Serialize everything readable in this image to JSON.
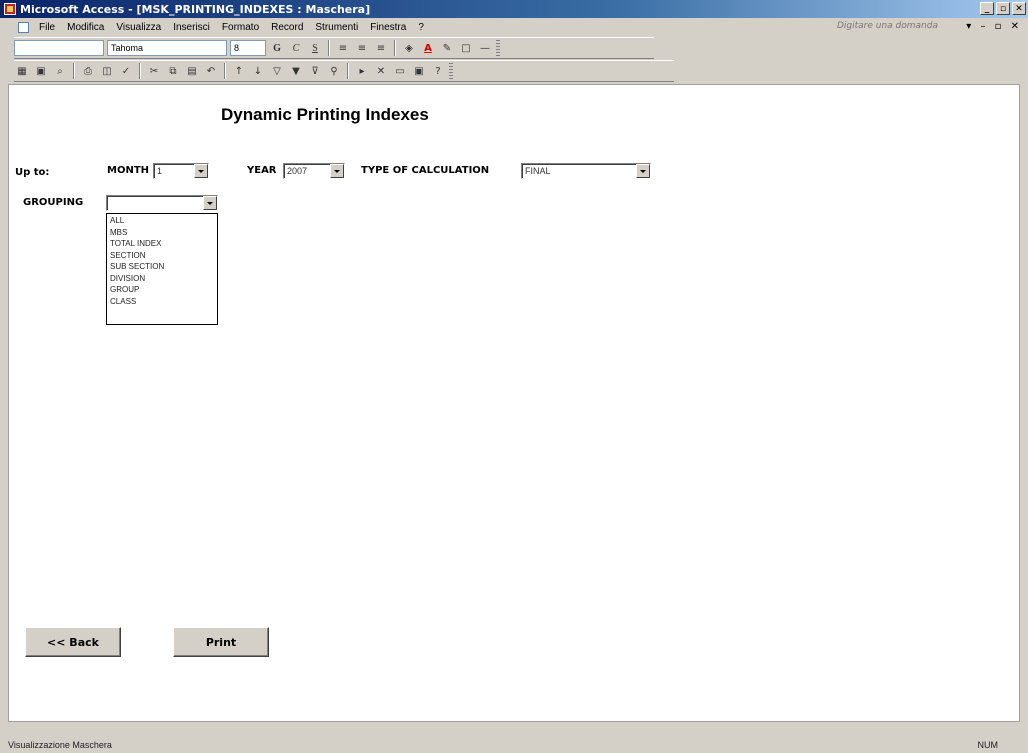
{
  "window": {
    "title": "Microsoft Access - [MSK_PRINTING_INDEXES : Maschera]"
  },
  "menubar": {
    "items": [
      "File",
      "Modifica",
      "Visualizza",
      "Inserisci",
      "Formato",
      "Record",
      "Strumenti",
      "Finestra",
      "?"
    ],
    "question_box": "Digitare una domanda"
  },
  "toolbar": {
    "font_name": "Tahoma",
    "font_size": "8"
  },
  "form": {
    "title": "Dynamic Printing Indexes",
    "up_to_label": "Up to:",
    "month_label": "MONTH",
    "month_value": "1",
    "year_label": "YEAR",
    "year_value": "2007",
    "calc_label": "TYPE OF CALCULATION",
    "calc_value": "FINAL",
    "grouping_label": "GROUPING",
    "grouping_value": "",
    "grouping_options": [
      "ALL",
      "MBS",
      "TOTAL INDEX",
      "SECTION",
      "SUB SECTION",
      "DIVISION",
      "GROUP",
      "CLASS"
    ],
    "back_button": "<< Back",
    "print_button": "Print"
  },
  "statusbar": {
    "left": "Visualizzazione Maschera",
    "right": "NUM"
  }
}
